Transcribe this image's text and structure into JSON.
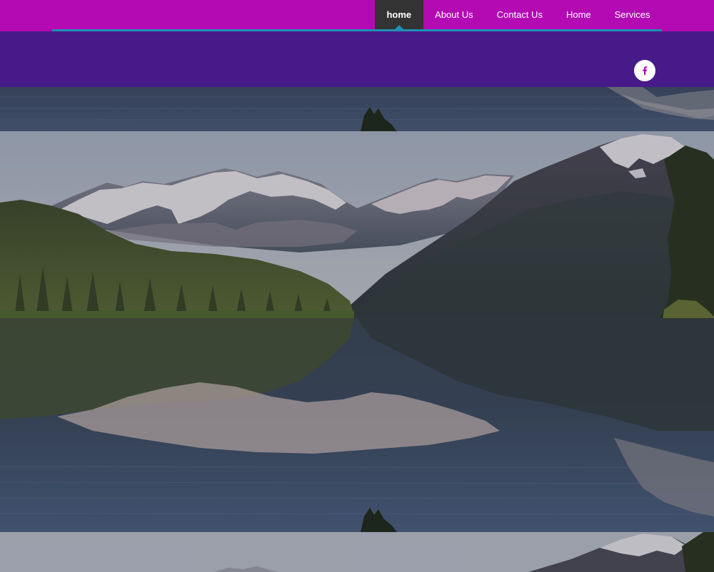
{
  "nav": {
    "items": [
      {
        "label": "home",
        "active": true
      },
      {
        "label": "About Us",
        "active": false
      },
      {
        "label": "Contact Us",
        "active": false
      },
      {
        "label": "Home",
        "active": false
      },
      {
        "label": "Services",
        "active": false
      }
    ]
  },
  "social": {
    "facebook_glyph": "f",
    "icon": "facebook-icon"
  },
  "colors": {
    "topbar": "#b30ab4",
    "header_band": "#471a8a",
    "accent_line": "#1f8fb4",
    "active_tab": "#333333"
  }
}
